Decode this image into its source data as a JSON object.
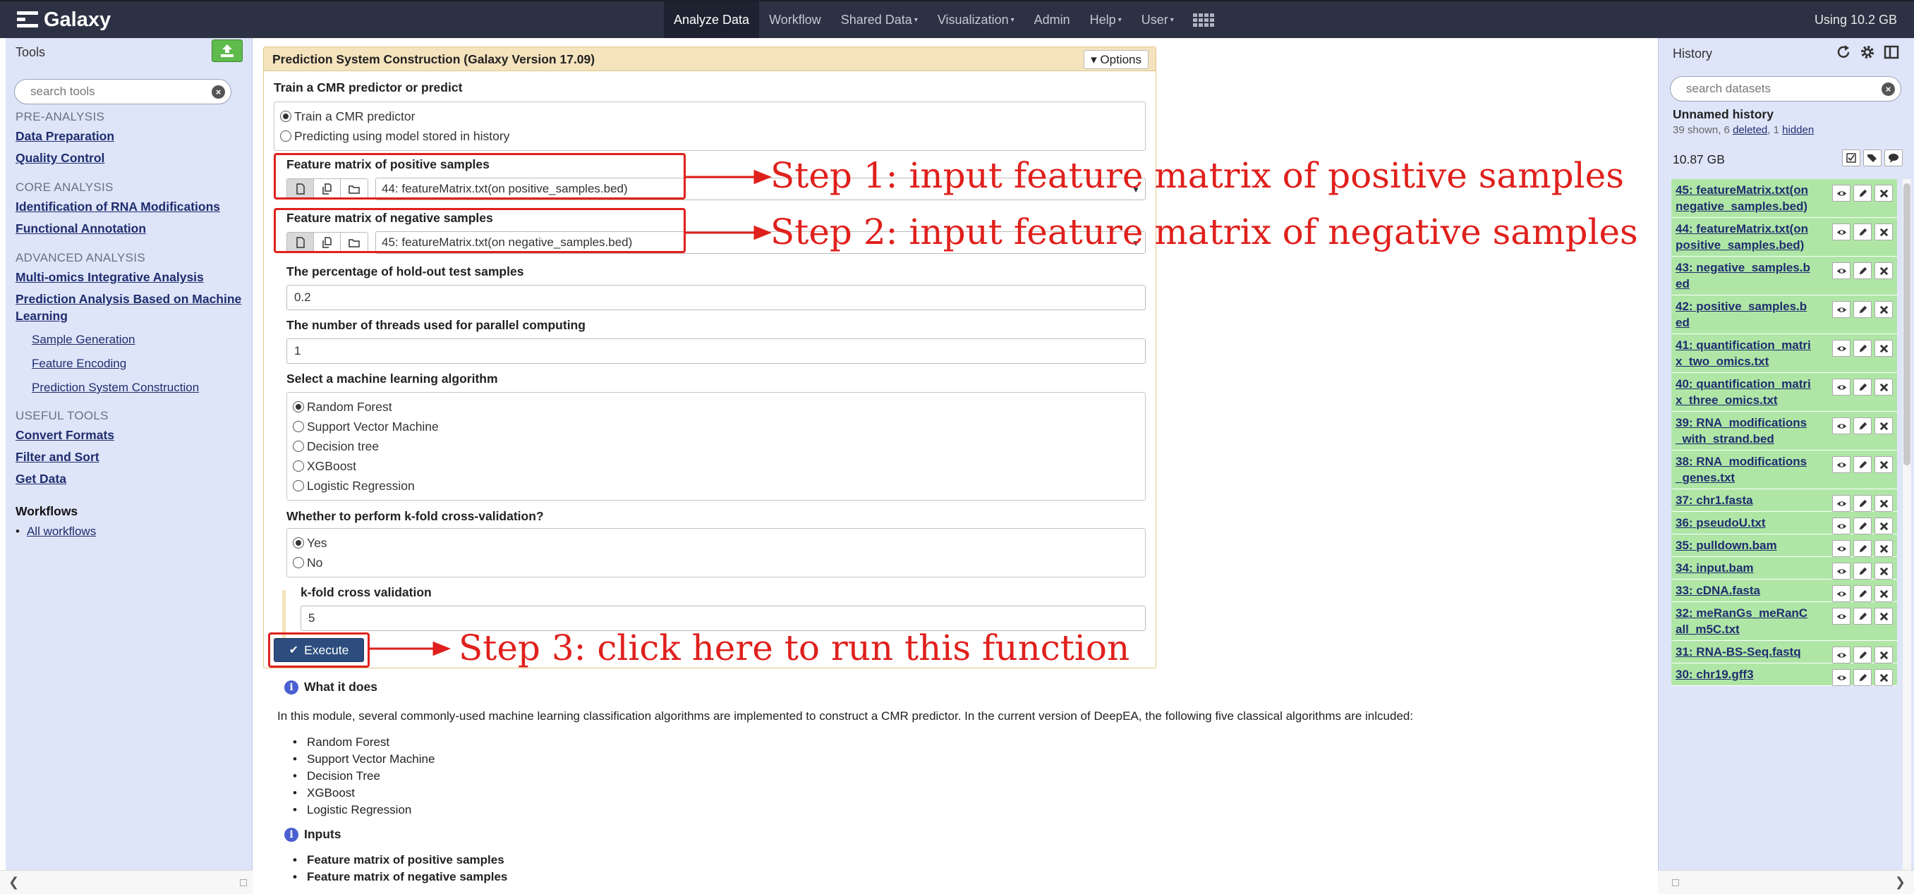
{
  "masthead": {
    "brand": "Galaxy",
    "nav": [
      {
        "label": "Analyze Data",
        "active": true,
        "caret": false
      },
      {
        "label": "Workflow",
        "active": false,
        "caret": false
      },
      {
        "label": "Shared Data",
        "active": false,
        "caret": true
      },
      {
        "label": "Visualization",
        "active": false,
        "caret": true
      },
      {
        "label": "Admin",
        "active": false,
        "caret": false
      },
      {
        "label": "Help",
        "active": false,
        "caret": true
      },
      {
        "label": "User",
        "active": false,
        "caret": true
      }
    ],
    "quota": "Using 10.2 GB"
  },
  "tools_panel": {
    "title": "Tools",
    "search_placeholder": "search tools",
    "sections": {
      "pre_analysis": "PRE-ANALYSIS",
      "data_preparation": "Data Preparation",
      "quality_control": "Quality Control",
      "core_analysis": "CORE ANALYSIS",
      "identification": "Identification of RNA Modifications",
      "functional_annotation": "Functional Annotation",
      "advanced_analysis": "ADVANCED ANALYSIS",
      "multi_omics": "Multi-omics Integrative Analysis",
      "prediction_ml": "Prediction Analysis Based on Machine Learning",
      "sample_generation": "Sample Generation",
      "feature_encoding": "Feature Encoding",
      "prediction_system": "Prediction System Construction",
      "useful_tools": "USEFUL TOOLS",
      "convert_formats": "Convert Formats",
      "filter_sort": "Filter and Sort",
      "get_data": "Get Data",
      "workflows": "Workflows",
      "all_workflows": "All workflows"
    }
  },
  "tool_form": {
    "title": "Prediction System Construction (Galaxy Version 17.09)",
    "options_label": "Options",
    "mode_label": "Train a CMR predictor or predict",
    "mode_options": [
      "Train a CMR predictor",
      "Predicting using model stored in history"
    ],
    "mode_selected": "Train a CMR predictor",
    "positive_label": "Feature matrix of positive samples",
    "positive_value": "44: featureMatrix.txt(on positive_samples.bed)",
    "negative_label": "Feature matrix of negative samples",
    "negative_value": "45: featureMatrix.txt(on negative_samples.bed)",
    "holdout_label": "The percentage of hold-out test samples",
    "holdout_value": "0.2",
    "threads_label": "The number of threads used for parallel computing",
    "threads_value": "1",
    "algo_label": "Select a machine learning algorithm",
    "algo_options": [
      "Random Forest",
      "Support Vector Machine",
      "Decision tree",
      "XGBoost",
      "Logistic Regression"
    ],
    "algo_selected": "Random Forest",
    "cv_label": "Whether to perform k-fold cross-validation?",
    "cv_options": [
      "Yes",
      "No"
    ],
    "cv_selected": "Yes",
    "kfold_label": "k-fold cross validation",
    "kfold_value": "5",
    "execute_label": "Execute"
  },
  "annotations": {
    "step1": "Step 1: input feature matrix of positive samples",
    "step2": "Step 2: input feature matrix of negative samples",
    "step3": "Step 3: click here to run this function",
    "color": "#e0201c"
  },
  "help": {
    "what_title": "What it does",
    "what_text": "In this module, several commonly-used machine learning classification algorithms are implemented to construct a CMR predictor. In the current version of DeepEA, the following five classical algorithms are inlcuded:",
    "algorithms": [
      "Random Forest",
      "Support Vector Machine",
      "Decision Tree",
      "XGBoost",
      "Logistic Regression"
    ],
    "inputs_title": "Inputs",
    "inputs": [
      "Feature matrix of positive samples",
      "Feature matrix of negative samples"
    ]
  },
  "history": {
    "title": "History",
    "search_placeholder": "search datasets",
    "name": "Unnamed history",
    "stats_prefix": "39 shown, 6 ",
    "stats_deleted": "deleted",
    "stats_mid": ", 1 ",
    "stats_hidden": "hidden",
    "size": "10.87 GB",
    "datasets": [
      "45: featureMatrix.txt(on negative_samples.bed)",
      "44: featureMatrix.txt(on positive_samples.bed)",
      "43: negative_samples.bed",
      "42: positive_samples.bed",
      "41: quantification_matrix_two_omics.txt",
      "40: quantification_matrix_three_omics.txt",
      "39: RNA_modifications_with_strand.bed",
      "38: RNA_modifications_genes.txt",
      "37: chr1.fasta",
      "36: pseudoU.txt",
      "35: pulldown.bam",
      "34: input.bam",
      "33: cDNA.fasta",
      "32: meRanGs_meRanCall_m5C.txt",
      "31: RNA-BS-Seq.fastq",
      "30: chr19.gff3"
    ],
    "dataset_color": "#afe6a6"
  }
}
